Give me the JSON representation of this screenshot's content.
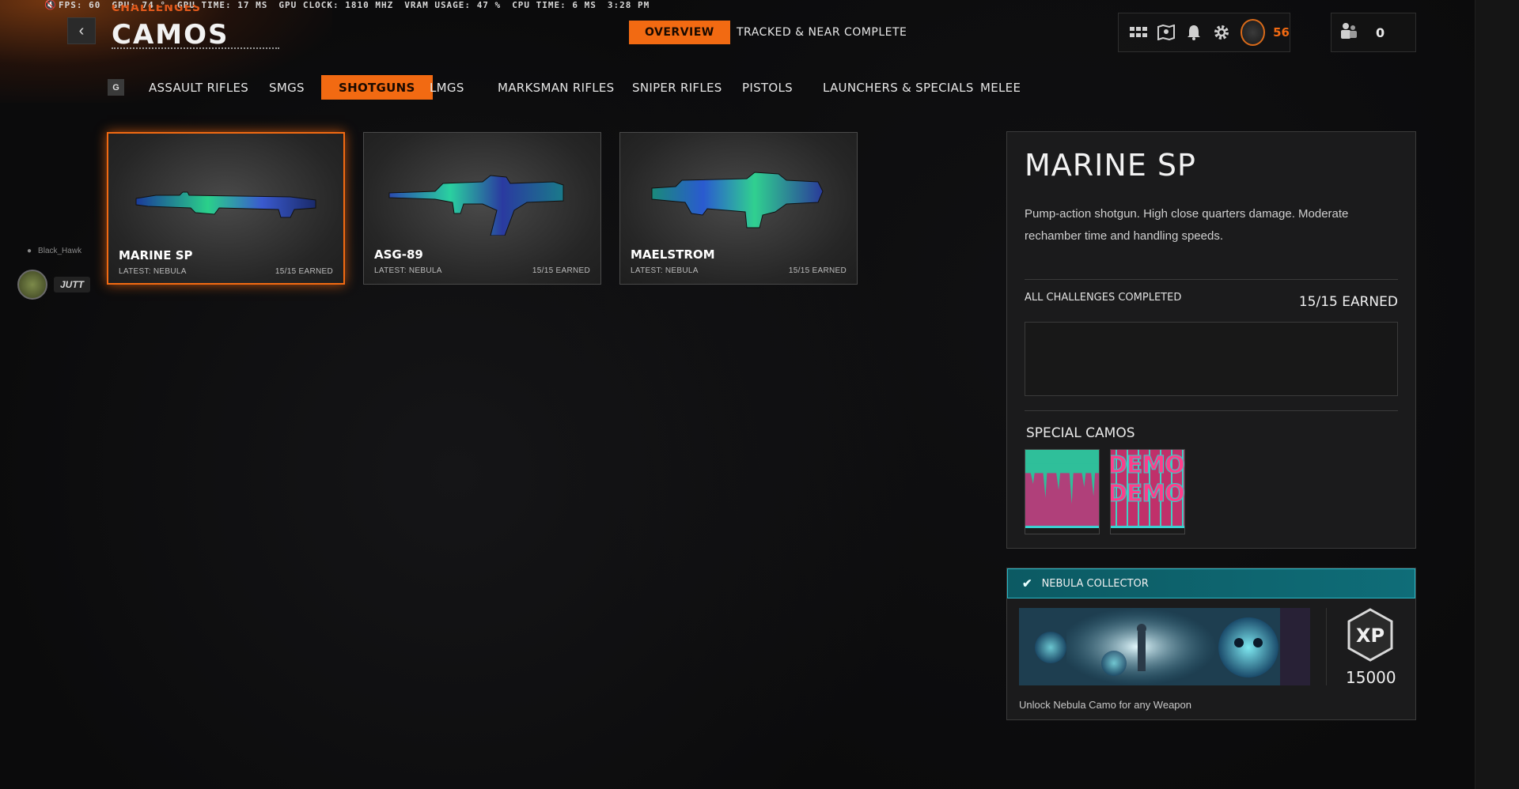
{
  "perf": {
    "fps_label": "FPS:",
    "fps": "60",
    "gpu_label": "GPU:",
    "gpu": "74 °",
    "gpu_time_label": "GPU TIME:",
    "gpu_time": "17 MS",
    "gpu_clock_label": "GPU CLOCK:",
    "gpu_clock": "1810 MHZ",
    "vram_label": "VRAM USAGE:",
    "vram": "47 %",
    "cpu_time_label": "CPU TIME:",
    "cpu_time": "6 MS",
    "clock": "3:28 PM"
  },
  "header": {
    "supertitle": "CHALLENGES",
    "title": "CAMOS",
    "back_icon": "chevron-left-icon"
  },
  "top_tabs": [
    {
      "label": "OVERVIEW",
      "active": true
    },
    {
      "label": "TRACKED & NEAR COMPLETE",
      "active": false
    }
  ],
  "hud": {
    "icons": [
      "grid-icon",
      "map-icon",
      "bell-icon",
      "gear-icon"
    ],
    "level": "56",
    "friends_online": "0",
    "accent": "#f26a12"
  },
  "categories": {
    "key_hint": "G",
    "items": [
      {
        "label": "ASSAULT RIFLES",
        "active": false
      },
      {
        "label": "SMGS",
        "active": false
      },
      {
        "label": "SHOTGUNS",
        "active": true
      },
      {
        "label": "LMGS",
        "active": false
      },
      {
        "label": "MARKSMAN RIFLES",
        "active": false
      },
      {
        "label": "SNIPER RIFLES",
        "active": false
      },
      {
        "label": "PISTOLS",
        "active": false
      },
      {
        "label": "LAUNCHERS & SPECIALS",
        "active": false
      },
      {
        "label": "MELEE",
        "active": false
      }
    ]
  },
  "weapons": [
    {
      "name": "MARINE SP",
      "sub": "LATEST: NEBULA",
      "earned": "15/15 EARNED",
      "selected": true
    },
    {
      "name": "ASG-89",
      "sub": "LATEST: NEBULA",
      "earned": "15/15 EARNED",
      "selected": false
    },
    {
      "name": "MAELSTROM",
      "sub": "LATEST: NEBULA",
      "earned": "15/15 EARNED",
      "selected": false
    }
  ],
  "side_users": {
    "user1": "Black_Hawk",
    "user2": "JUTT"
  },
  "detail": {
    "title": "MARINE SP",
    "description": "Pump-action shotgun.  High close quarters damage. Moderate rechamber time and handling speeds.",
    "challenges_label": "ALL CHALLENGES COMPLETED",
    "challenges_earned": "15/15 EARNED",
    "special_camos_label": "SPECIAL CAMOS",
    "special_camos": [
      "DEMON"
    ]
  },
  "reward": {
    "name": "NEBULA COLLECTOR",
    "xp": "15000",
    "xp_icon": "XP",
    "unlock_text": "Unlock Nebula Camo for any Weapon",
    "banner_color": "#0f6d78"
  }
}
